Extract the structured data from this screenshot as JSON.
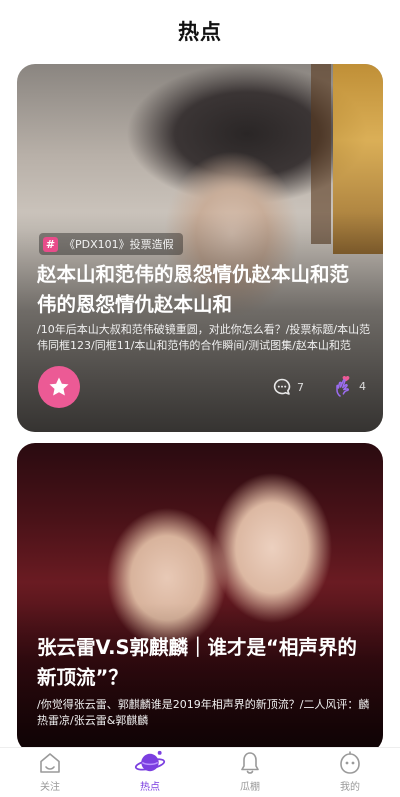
{
  "header": {
    "title": "热点"
  },
  "cards": [
    {
      "tag": "《PDX101》投票造假",
      "title": "赵本山和范伟的恩怨情仇赵本山和范伟的恩怨情仇赵本山和",
      "description": "/10年后本山大叔和范伟破镜重圆，对此你怎么看？/投票标题/本山范伟同框123/同框11/本山和范伟的合作瞬间/测试图集/赵本山和范伟...",
      "comment_count": "7",
      "like_count": "4"
    },
    {
      "title": "张云雷V.S郭麒麟｜谁才是“相声界的新顶流”？",
      "description": "/你觉得张云雷、郭麒麟谁是2019年相声界的新顶流？/二人风评：麟热雷凉/张云雷&郭麒麟"
    }
  ],
  "tabbar": {
    "items": [
      {
        "label": "关注",
        "icon": "home-icon",
        "active": false
      },
      {
        "label": "热点",
        "icon": "planet-icon",
        "active": true
      },
      {
        "label": "瓜棚",
        "icon": "bell-icon",
        "active": false
      },
      {
        "label": "我的",
        "icon": "face-icon",
        "active": false
      }
    ]
  },
  "colors": {
    "accent": "#7b3fe0",
    "pink": "#ec5a95"
  }
}
